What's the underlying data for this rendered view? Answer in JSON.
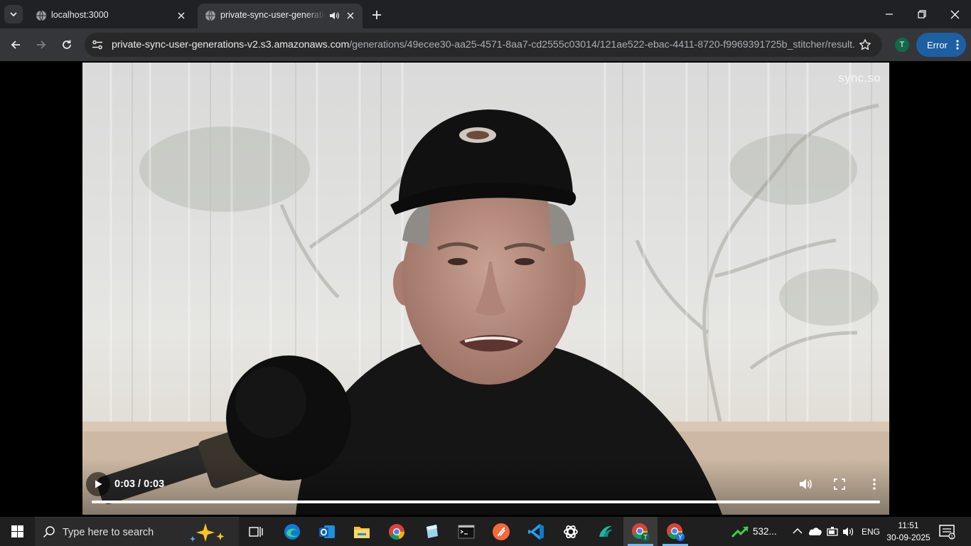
{
  "browser": {
    "tabs": [
      {
        "title": "localhost:3000",
        "favicon": "globe-icon",
        "active": false,
        "audio": false
      },
      {
        "title": "private-sync-user-generations-v2.s3.amazonaws.com",
        "favicon": "globe-icon",
        "active": true,
        "audio": true
      }
    ],
    "url_host": "private-sync-user-generations-v2.s3.amazonaws.com",
    "url_path": "/generations/49ecee30-aa25-4571-8aa7-cd2555c03014/121ae522-ebac-4411-8720-f9969391725b_stitcher/result....",
    "profile_initial": "T",
    "error_label": "Error",
    "accent_color": "#1d5fa3"
  },
  "video": {
    "watermark": "sync.so",
    "time_display": "0:03 / 0:03",
    "progress": 1.0,
    "state": "paused"
  },
  "taskbar": {
    "search_placeholder": "Type here to search",
    "apps": [
      "task-view-icon",
      "edge-icon",
      "outlook-icon",
      "file-explorer-icon",
      "chrome-icon",
      "notepad-icon",
      "terminal-icon",
      "app-icon",
      "vscode-icon",
      "chatgpt-icon",
      "windsurf-icon",
      "chrome-profile-t-icon",
      "chrome-profile-y-icon"
    ],
    "stock_value": "532...",
    "language": "ENG",
    "time": "11:51",
    "date": "30-09-2025"
  }
}
